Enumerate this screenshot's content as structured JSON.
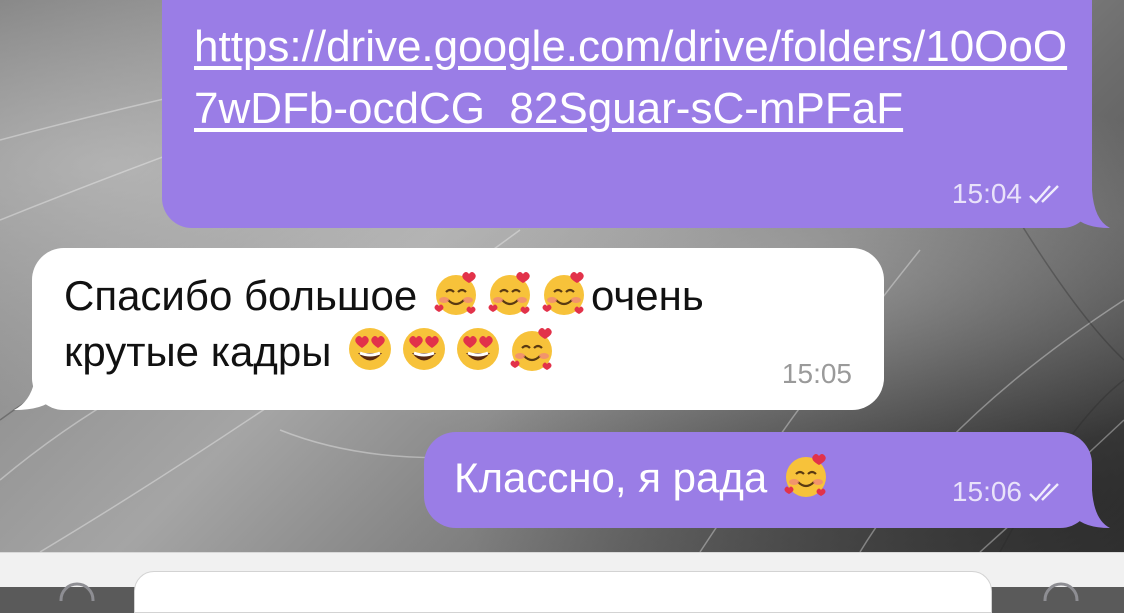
{
  "messages": [
    {
      "direction": "outgoing",
      "link": "https://drive.google.com/drive/folders/10OoO7wDFb-ocdCG_82Sguar-sC-mPFaF",
      "time": "15:04",
      "status": "read",
      "status_icon": "double-check-icon"
    },
    {
      "direction": "incoming",
      "text_line1": "Спасибо большое",
      "text_line1_tail": "очень",
      "text_line2": "крутые кадры",
      "time": "15:05",
      "emojis_line1": [
        "smiling-face-with-hearts",
        "smiling-face-with-hearts",
        "smiling-face-with-hearts"
      ],
      "emojis_line2": [
        "heart-eyes",
        "heart-eyes",
        "heart-eyes",
        "smiling-face-with-hearts"
      ]
    },
    {
      "direction": "outgoing",
      "text": "Классно, я рада",
      "emoji": "smiling-face-with-hearts",
      "time": "15:06",
      "status": "read",
      "status_icon": "double-check-icon"
    }
  ],
  "colors": {
    "outgoing_bubble": "#9a7de6",
    "incoming_bubble": "#ffffff",
    "composer_bg": "#f1f1f1"
  }
}
